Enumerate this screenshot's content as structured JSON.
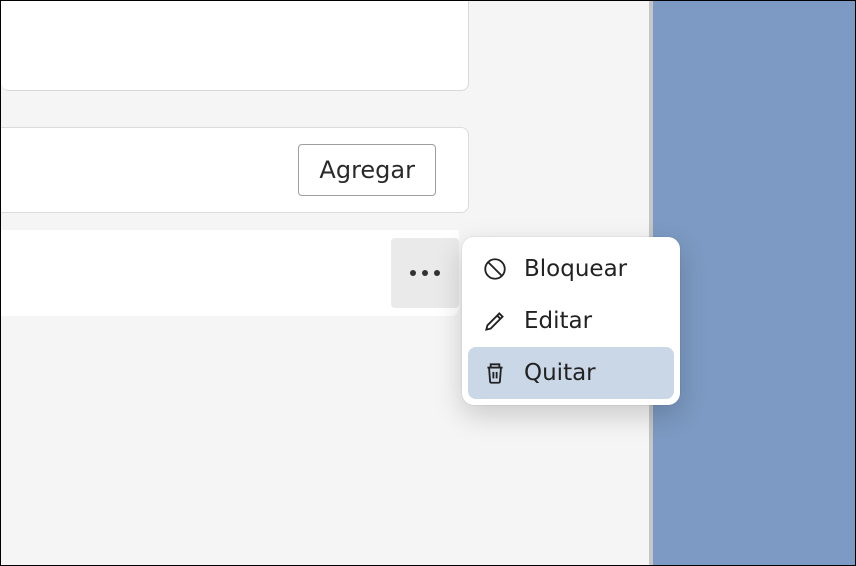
{
  "add_button": {
    "label": "Agregar"
  },
  "context_menu": {
    "items": [
      {
        "label": "Bloquear",
        "icon": "block-icon",
        "hovered": false
      },
      {
        "label": "Editar",
        "icon": "edit-icon",
        "hovered": false
      },
      {
        "label": "Quitar",
        "icon": "trash-icon",
        "hovered": true
      }
    ]
  },
  "colors": {
    "sidebar_blue": "#7c9ac3",
    "menu_hover": "#cad7e6"
  }
}
